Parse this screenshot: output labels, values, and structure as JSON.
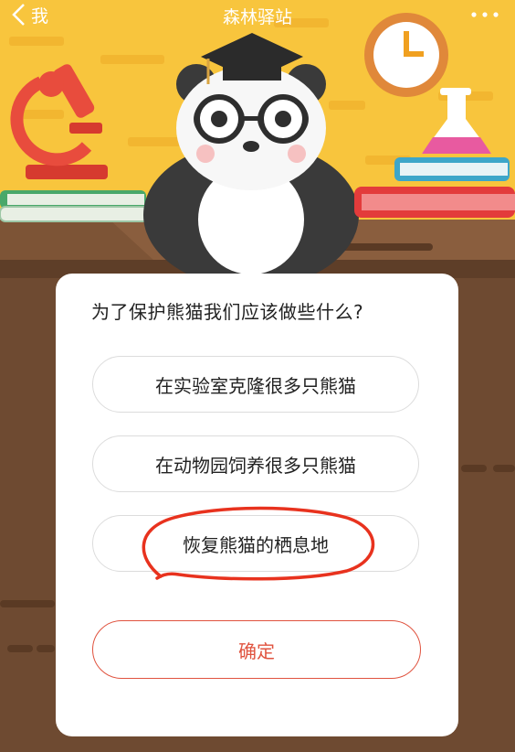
{
  "nav": {
    "back_label": "我",
    "title": "森林驿站"
  },
  "question": "为了保护熊猫我们应该做些什么?",
  "options": [
    {
      "label": "在实验室克隆很多只熊猫"
    },
    {
      "label": "在动物园饲养很多只熊猫"
    },
    {
      "label": "恢复熊猫的栖息地"
    }
  ],
  "confirm_label": "确定",
  "colors": {
    "accent": "#e0533f",
    "wall": "#f8c53d",
    "desk": "#6e4a31",
    "annotation": "#e8321e"
  }
}
